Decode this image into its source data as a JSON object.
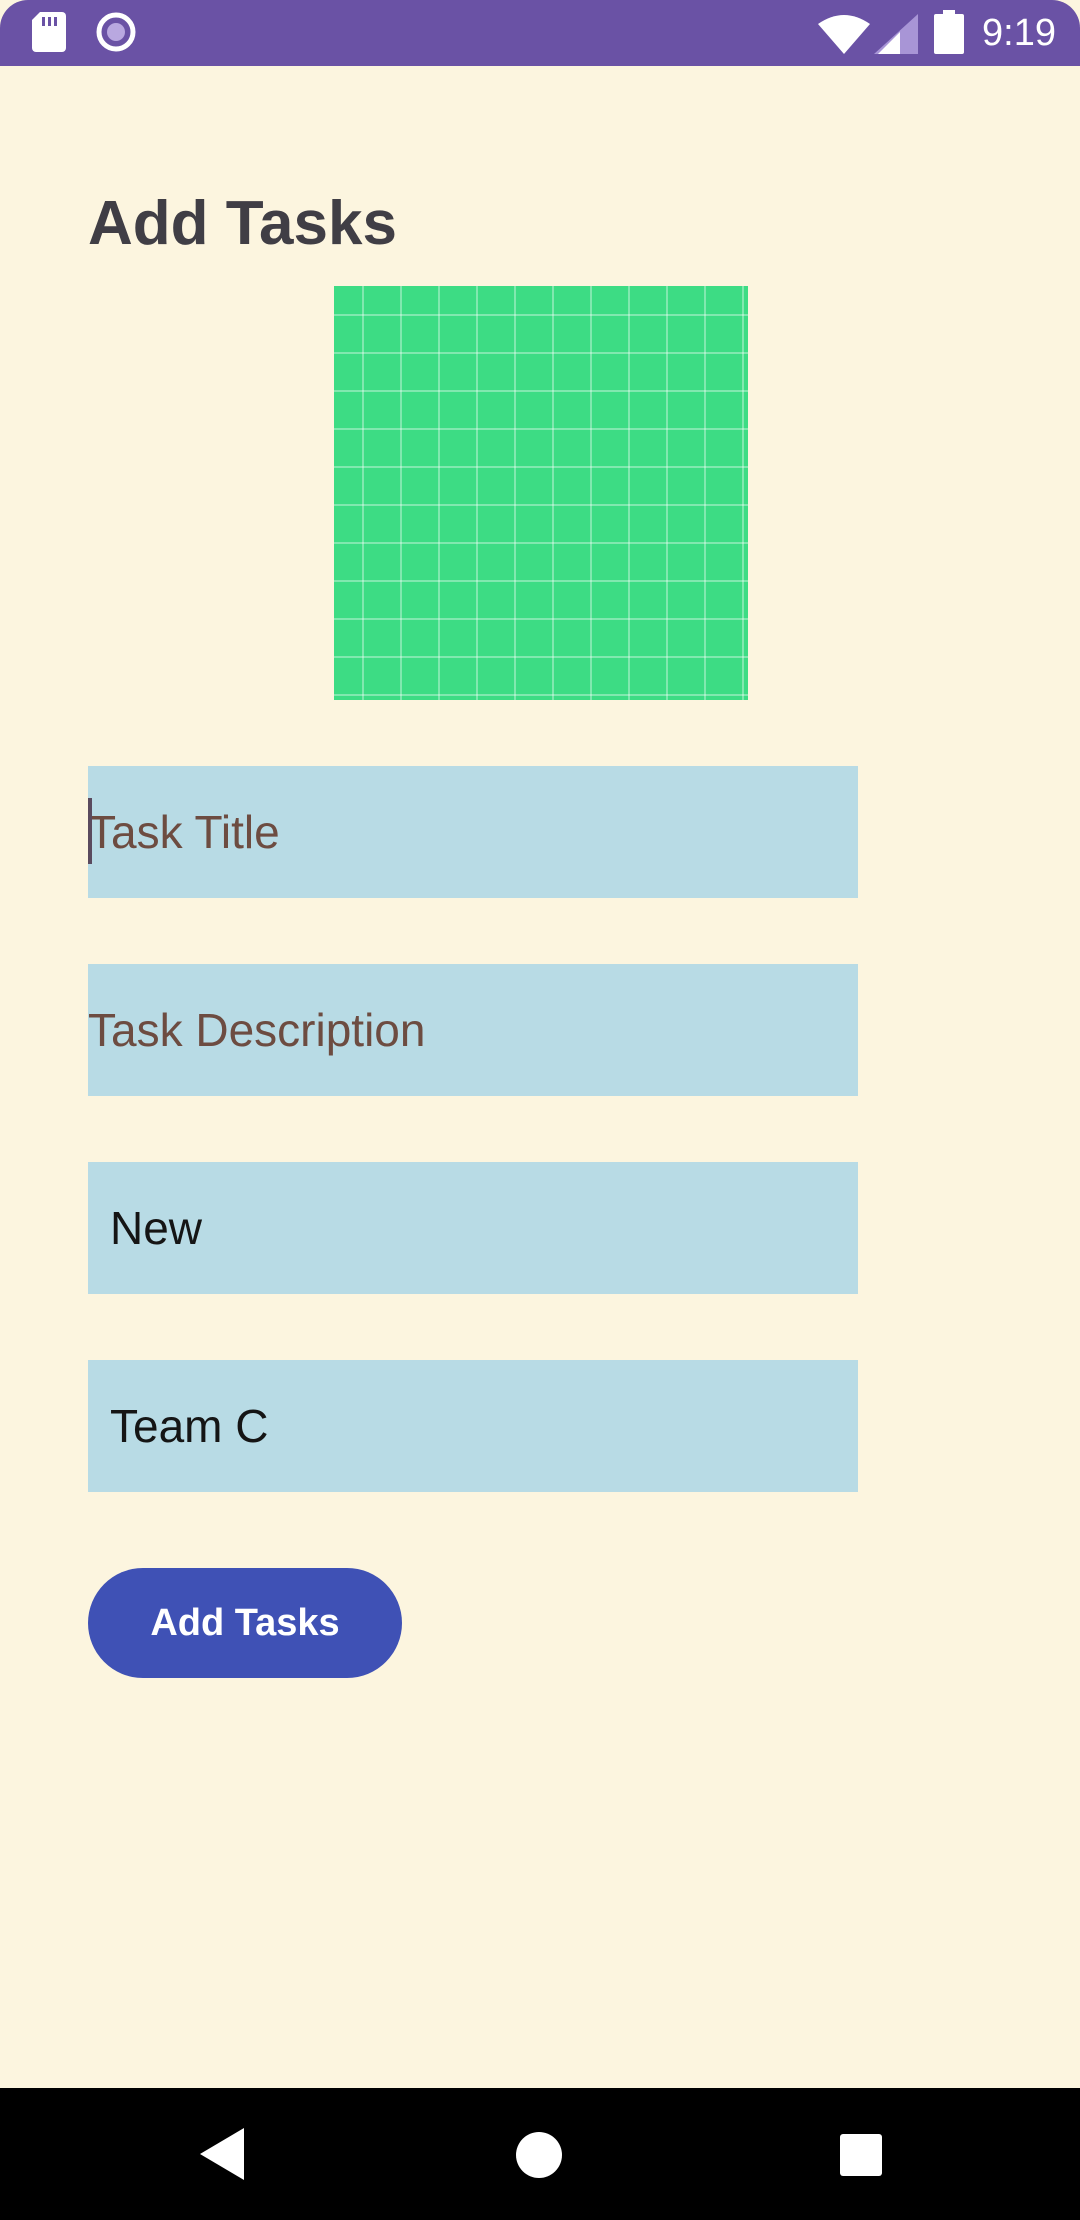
{
  "status_bar": {
    "time": "9:19",
    "icons": [
      "sd-card-icon",
      "circle-notification-icon",
      "wifi-icon",
      "signal-icon",
      "battery-icon"
    ]
  },
  "page": {
    "title": "Add Tasks"
  },
  "form": {
    "title_field": {
      "value": "",
      "placeholder": "Task Title"
    },
    "description_field": {
      "value": "",
      "placeholder": "Task Description"
    },
    "status_field": {
      "value": "New"
    },
    "team_field": {
      "value": "Team C"
    },
    "submit_label": "Add Tasks"
  },
  "nav_bar": {
    "icons": [
      "back-icon",
      "home-icon",
      "recents-icon"
    ]
  },
  "colors": {
    "status_bar": "#6a52a5",
    "background": "#fcf5df",
    "field_background": "#b8dbe5",
    "button": "#3f51b5",
    "image": "#3ddc84"
  }
}
